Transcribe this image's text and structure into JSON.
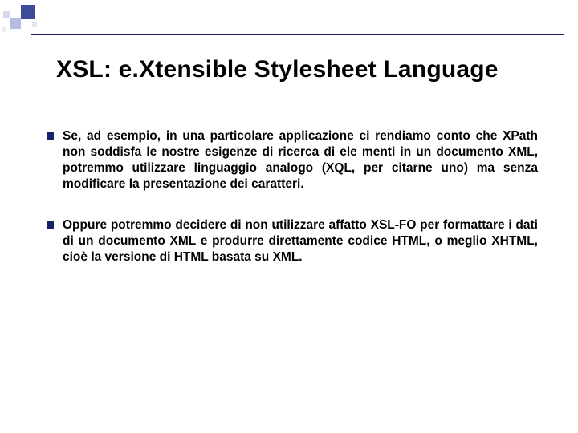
{
  "title": "XSL: e.Xtensible Stylesheet Language",
  "bullets": [
    {
      "text": "Se, ad esempio, in una particolare applicazione ci rendiamo conto che XPath non soddisfa le nostre esigenze di ricerca di ele menti in un documento XML, potremmo utilizzare linguaggio analogo (XQL, per citarne uno) ma senza modificare la presentazione dei caratteri."
    },
    {
      "text": "Oppure potremmo decidere di non utilizzare affatto XSL-FO per formattare i dati di un documento XML e produrre direttamente codice HTML, o meglio XHTML, cioè la versione di HTML basata su XML."
    }
  ]
}
